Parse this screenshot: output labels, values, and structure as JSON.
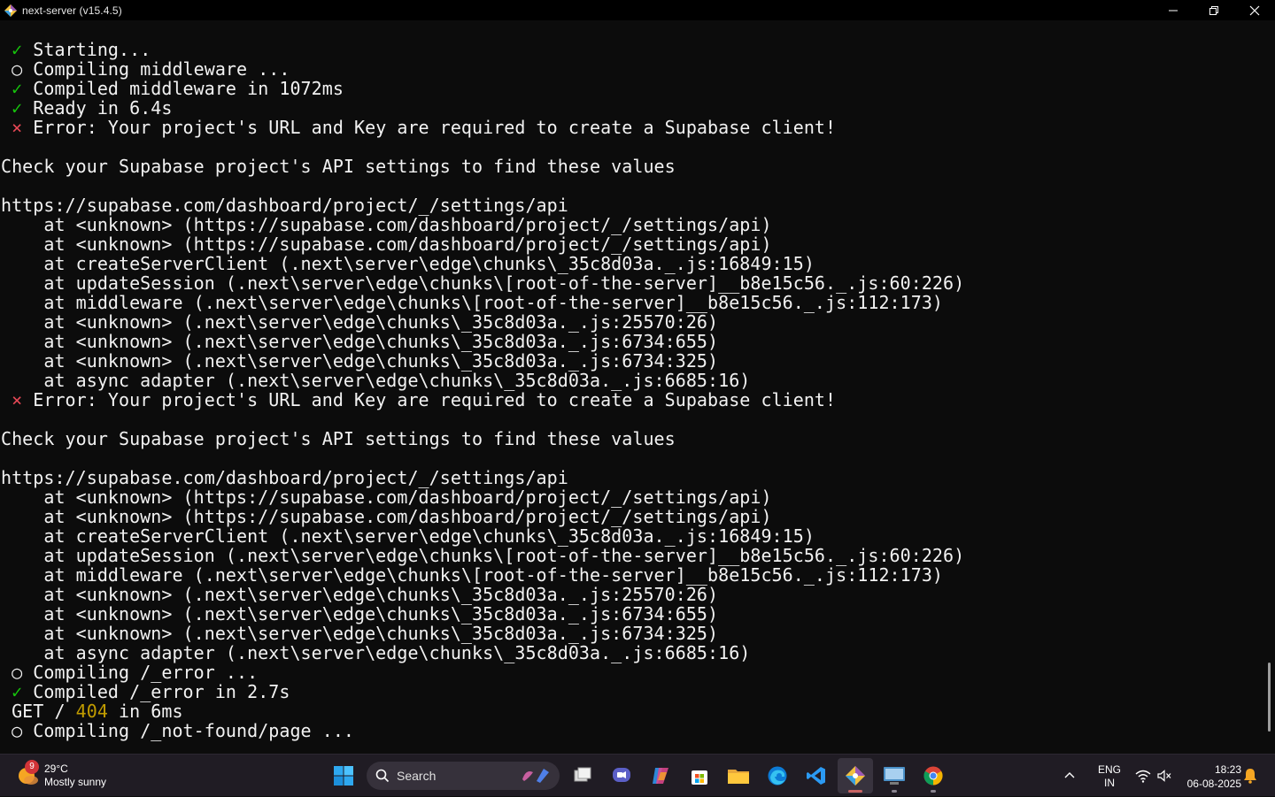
{
  "window": {
    "title": "next-server (v15.4.5)",
    "icon": "git-bash-diamond-icon"
  },
  "terminal": {
    "lines": [
      [
        {
          "t": " "
        },
        {
          "t": "✓",
          "c": "c-green"
        },
        {
          "t": " Starting...",
          "c": "c-white"
        }
      ],
      [
        {
          "t": " "
        },
        {
          "t": "○",
          "c": "c-white"
        },
        {
          "t": " Compiling middleware ...",
          "c": "c-white"
        }
      ],
      [
        {
          "t": " "
        },
        {
          "t": "✓",
          "c": "c-green"
        },
        {
          "t": " Compiled middleware in 1072ms",
          "c": "c-white"
        }
      ],
      [
        {
          "t": " "
        },
        {
          "t": "✓",
          "c": "c-green"
        },
        {
          "t": " Ready in 6.4s",
          "c": "c-white"
        }
      ],
      [
        {
          "t": " "
        },
        {
          "t": "⨯",
          "c": "c-red"
        },
        {
          "t": " Error: Your project's URL and Key are required to create a Supabase client!",
          "c": "c-white"
        }
      ],
      [
        {
          "t": ""
        }
      ],
      [
        {
          "t": "Check your Supabase project's API settings to find these values",
          "c": "c-white"
        }
      ],
      [
        {
          "t": ""
        }
      ],
      [
        {
          "t": "https://supabase.com/dashboard/project/_/settings/api",
          "c": "c-white"
        }
      ],
      [
        {
          "t": "    at <unknown> (https://supabase.com/dashboard/project/_/settings/api)",
          "c": "c-white"
        }
      ],
      [
        {
          "t": "    at <unknown> (https://supabase.com/dashboard/project/_/settings/api)",
          "c": "c-white"
        }
      ],
      [
        {
          "t": "    at createServerClient (.next\\server\\edge\\chunks\\_35c8d03a._.js:16849:15)",
          "c": "c-white"
        }
      ],
      [
        {
          "t": "    at updateSession (.next\\server\\edge\\chunks\\[root-of-the-server]__b8e15c56._.js:60:226)",
          "c": "c-white"
        }
      ],
      [
        {
          "t": "    at middleware (.next\\server\\edge\\chunks\\[root-of-the-server]__b8e15c56._.js:112:173)",
          "c": "c-white"
        }
      ],
      [
        {
          "t": "    at <unknown> (.next\\server\\edge\\chunks\\_35c8d03a._.js:25570:26)",
          "c": "c-white"
        }
      ],
      [
        {
          "t": "    at <unknown> (.next\\server\\edge\\chunks\\_35c8d03a._.js:6734:655)",
          "c": "c-white"
        }
      ],
      [
        {
          "t": "    at <unknown> (.next\\server\\edge\\chunks\\_35c8d03a._.js:6734:325)",
          "c": "c-white"
        }
      ],
      [
        {
          "t": "    at async adapter (.next\\server\\edge\\chunks\\_35c8d03a._.js:6685:16)",
          "c": "c-white"
        }
      ],
      [
        {
          "t": " "
        },
        {
          "t": "⨯",
          "c": "c-red"
        },
        {
          "t": " Error: Your project's URL and Key are required to create a Supabase client!",
          "c": "c-white"
        }
      ],
      [
        {
          "t": ""
        }
      ],
      [
        {
          "t": "Check your Supabase project's API settings to find these values",
          "c": "c-white"
        }
      ],
      [
        {
          "t": ""
        }
      ],
      [
        {
          "t": "https://supabase.com/dashboard/project/_/settings/api",
          "c": "c-white"
        }
      ],
      [
        {
          "t": "    at <unknown> (https://supabase.com/dashboard/project/_/settings/api)",
          "c": "c-white"
        }
      ],
      [
        {
          "t": "    at <unknown> (https://supabase.com/dashboard/project/_/settings/api)",
          "c": "c-white"
        }
      ],
      [
        {
          "t": "    at createServerClient (.next\\server\\edge\\chunks\\_35c8d03a._.js:16849:15)",
          "c": "c-white"
        }
      ],
      [
        {
          "t": "    at updateSession (.next\\server\\edge\\chunks\\[root-of-the-server]__b8e15c56._.js:60:226)",
          "c": "c-white"
        }
      ],
      [
        {
          "t": "    at middleware (.next\\server\\edge\\chunks\\[root-of-the-server]__b8e15c56._.js:112:173)",
          "c": "c-white"
        }
      ],
      [
        {
          "t": "    at <unknown> (.next\\server\\edge\\chunks\\_35c8d03a._.js:25570:26)",
          "c": "c-white"
        }
      ],
      [
        {
          "t": "    at <unknown> (.next\\server\\edge\\chunks\\_35c8d03a._.js:6734:655)",
          "c": "c-white"
        }
      ],
      [
        {
          "t": "    at <unknown> (.next\\server\\edge\\chunks\\_35c8d03a._.js:6734:325)",
          "c": "c-white"
        }
      ],
      [
        {
          "t": "    at async adapter (.next\\server\\edge\\chunks\\_35c8d03a._.js:6685:16)",
          "c": "c-white"
        }
      ],
      [
        {
          "t": " "
        },
        {
          "t": "○",
          "c": "c-white"
        },
        {
          "t": " Compiling /_error ...",
          "c": "c-white"
        }
      ],
      [
        {
          "t": " "
        },
        {
          "t": "✓",
          "c": "c-green"
        },
        {
          "t": " Compiled /_error in 2.7s",
          "c": "c-white"
        }
      ],
      [
        {
          "t": " GET / ",
          "c": "c-white"
        },
        {
          "t": "404",
          "c": "c-yellow"
        },
        {
          "t": " in 6ms",
          "c": "c-white"
        }
      ],
      [
        {
          "t": " "
        },
        {
          "t": "○",
          "c": "c-white"
        },
        {
          "t": " Compiling /_not-found/page ...",
          "c": "c-white"
        }
      ]
    ]
  },
  "taskbar": {
    "weather": {
      "badge": "9",
      "temp": "29°C",
      "condition": "Mostly sunny"
    },
    "search": {
      "label": "Search"
    },
    "language": {
      "line1": "ENG",
      "line2": "IN"
    },
    "clock": {
      "time": "18:23",
      "date": "06-08-2025"
    }
  },
  "colors": {
    "terminal_bg": "#0c0c0c",
    "taskbar_bg": "#201c24",
    "success": "#16c60c",
    "error": "#e74856",
    "warning": "#c19c00"
  }
}
